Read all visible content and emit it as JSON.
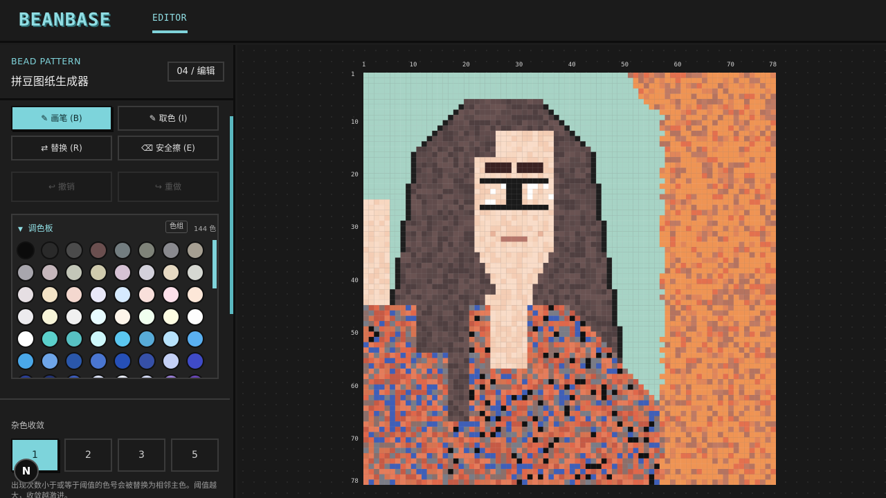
{
  "header": {
    "brand": "BEANBASE",
    "tab_editor": "EDITOR"
  },
  "sidebar": {
    "eyebrow": "BEAD PATTERN",
    "title": "拼豆图纸生成器",
    "step": "04 / 编辑",
    "tools": {
      "brush": "画笔 (B)",
      "picker": "取色 (I)",
      "replace": "替换 (R)",
      "safe_erase": "安全擦 (E)",
      "undo": "撤销",
      "redo": "重做"
    },
    "palette": {
      "title": "调色板",
      "group_badge": "色组",
      "count": "144 色",
      "swatches": [
        "#0b0b0b",
        "#2a2a2a",
        "#4b4b4b",
        "#6b4f4f",
        "#737d80",
        "#7f8379",
        "#8a8a8f",
        "#a69f92",
        "#a8a6ad",
        "#c5b6bb",
        "#c3c6b8",
        "#cfcaad",
        "#d6c2d4",
        "#d3d1db",
        "#e6d9c2",
        "#d6d8d2",
        "#e6dfe3",
        "#f3e3c6",
        "#f4d8cf",
        "#e9e8f8",
        "#d6eaff",
        "#f9e0db",
        "#fde0ea",
        "#fde7d8",
        "#ecebee",
        "#f7f4d8",
        "#f0f0f0",
        "#e7fbff",
        "#fdf5ea",
        "#f0ffef",
        "#fefde2",
        "#fdfdfd",
        "#ffffff",
        "#5bd0cb",
        "#57c0c2",
        "#cdf7fb",
        "#5bc7f0",
        "#58abd8",
        "#b7e2fb",
        "#5ab0f1",
        "#4aa8e9",
        "#6ea5e8",
        "#2a57aa",
        "#4a76d1",
        "#2650b7",
        "#3650a8",
        "#c4d0f5",
        "#3f4bc8"
      ]
    },
    "merge": {
      "label": "杂色收敛",
      "options": [
        "1",
        "2",
        "3",
        "5"
      ],
      "description": "出现次数小于或等于阈值的色号会被替换为相邻主色。阈值越大，收敛越激进。"
    },
    "badge": "N"
  },
  "canvas": {
    "columns": 78,
    "rows": 78,
    "x_ticks": [
      "1",
      "10",
      "20",
      "30",
      "40",
      "50",
      "60",
      "70",
      "78"
    ],
    "y_ticks": [
      "1",
      "10",
      "20",
      "30",
      "40",
      "50",
      "60",
      "70",
      "78"
    ]
  },
  "icons": {
    "brush": "pencil-icon",
    "picker": "eyedropper-icon",
    "replace": "swap-arrows-icon",
    "erase": "eraser-icon",
    "undo": "undo-arrow-icon",
    "redo": "redo-arrow-icon",
    "palette_toggle": "caret-down-icon"
  }
}
